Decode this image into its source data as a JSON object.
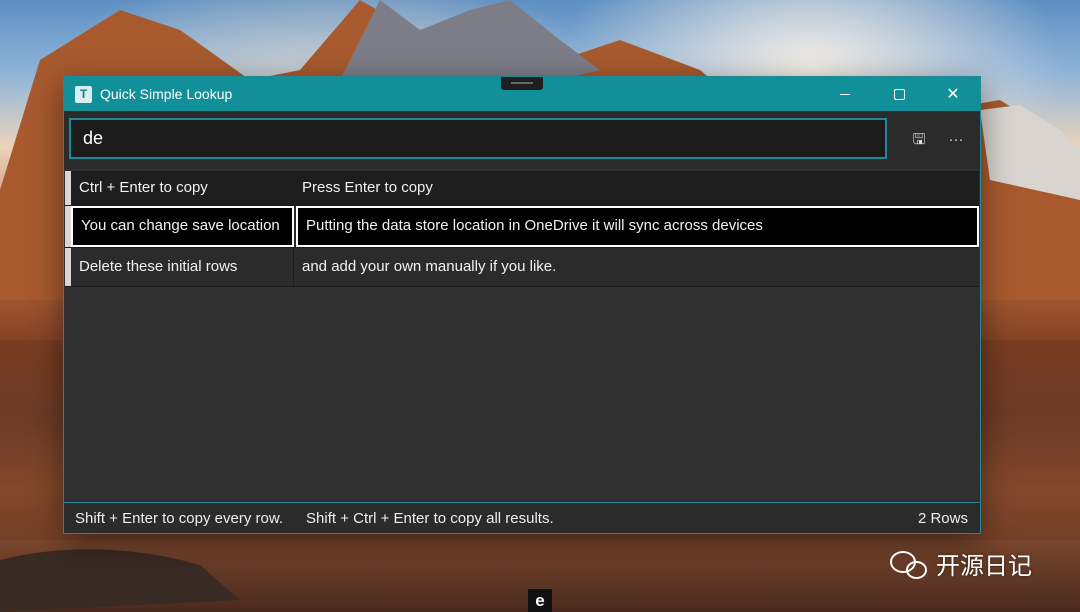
{
  "window": {
    "title": "Quick Simple Lookup",
    "app_icon_letter": "T"
  },
  "search": {
    "value": "de"
  },
  "toolbar": {
    "save_icon": "save-icon",
    "more_label": "···"
  },
  "grid": {
    "rows": [
      {
        "col1": "Ctrl + Enter to copy",
        "col2": "Press Enter to copy"
      },
      {
        "col1": "You can change save location",
        "col2": "Putting the data store location in OneDrive it will sync across devices"
      },
      {
        "col1": "Delete these initial rows",
        "col2": "and add your own manually if you like."
      }
    ]
  },
  "status": {
    "hint1": "Shift + Enter to copy every row.",
    "hint2": "Shift + Ctrl + Enter to copy all results.",
    "count": "2 Rows"
  },
  "desktop": {
    "taskbar_letter": "e",
    "watermark": "开源日记"
  },
  "colors": {
    "accent": "#12909a",
    "window_bg": "#303030",
    "selection_border": "#ffffff"
  }
}
